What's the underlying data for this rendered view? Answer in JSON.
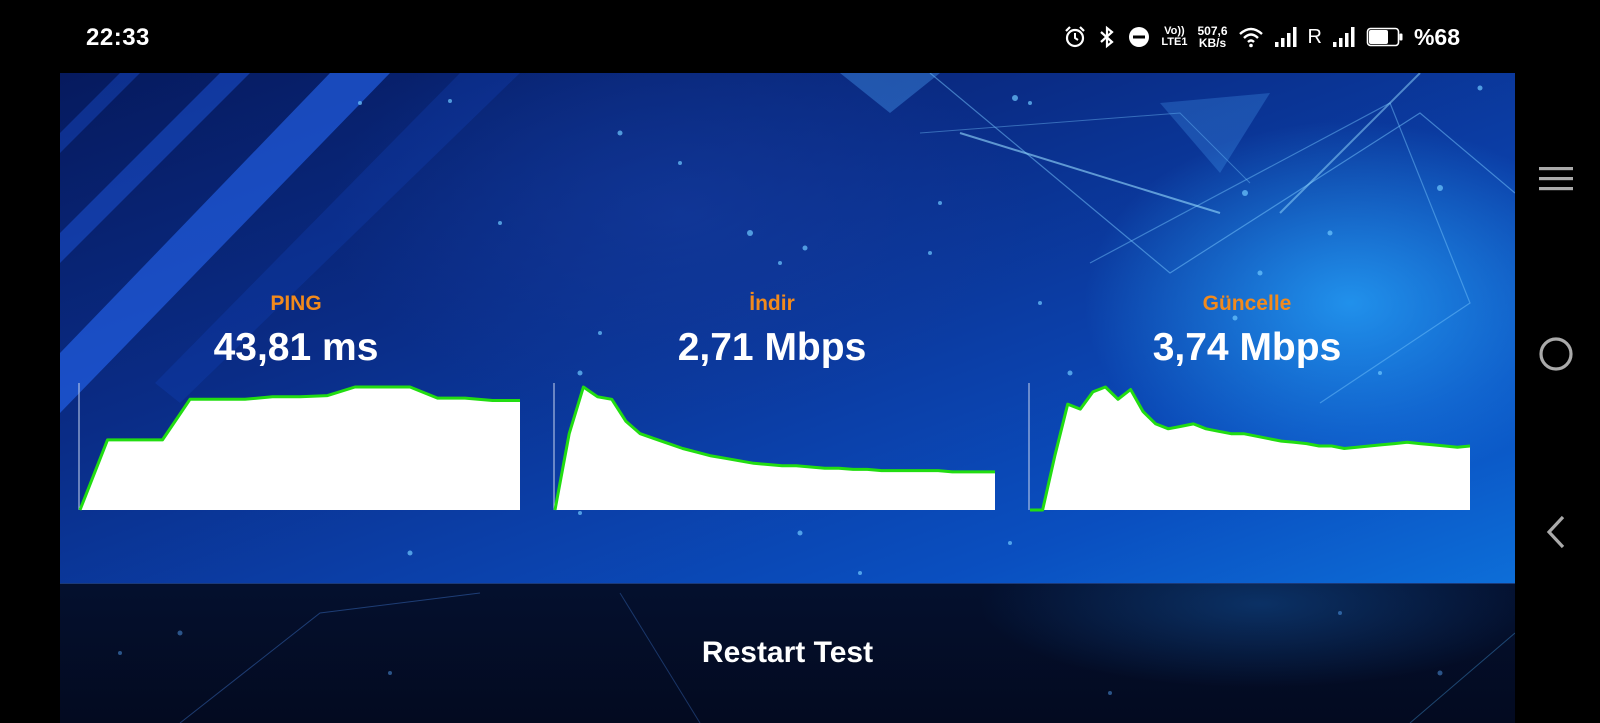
{
  "status_bar": {
    "time": "22:33",
    "volte_top": "Vo))",
    "volte_bottom": "LTE1",
    "net_speed_value": "507,6",
    "net_speed_unit": "KB/s",
    "roaming_label": "R",
    "battery_percent": "%68",
    "battery_level": 0.68,
    "icons": [
      "alarm-icon",
      "bluetooth-icon",
      "do-not-disturb-icon",
      "volte-icon",
      "wifi-icon",
      "signal-icon",
      "signal-icon",
      "battery-icon"
    ]
  },
  "results": {
    "ping": {
      "label": "PING",
      "value": "43,81 ms",
      "trend": [
        0,
        0.57,
        0.57,
        0.57,
        0.9,
        0.9,
        0.9,
        0.92,
        0.92,
        0.93,
        1.0,
        1.0,
        1.0,
        0.91,
        0.91,
        0.89,
        0.89
      ]
    },
    "download": {
      "label": "İndir",
      "value": "2,71 Mbps",
      "trend": [
        0,
        0.62,
        1.0,
        0.92,
        0.9,
        0.72,
        0.62,
        0.58,
        0.54,
        0.5,
        0.47,
        0.44,
        0.42,
        0.4,
        0.38,
        0.37,
        0.36,
        0.36,
        0.35,
        0.34,
        0.34,
        0.33,
        0.33,
        0.32,
        0.32,
        0.32,
        0.32,
        0.32,
        0.31,
        0.31,
        0.31,
        0.31
      ]
    },
    "upload": {
      "label": "Güncelle",
      "value": "3,74 Mbps",
      "trend": [
        0,
        0,
        0.45,
        0.86,
        0.82,
        0.96,
        1.0,
        0.9,
        0.98,
        0.8,
        0.7,
        0.66,
        0.68,
        0.7,
        0.66,
        0.64,
        0.62,
        0.62,
        0.6,
        0.58,
        0.56,
        0.55,
        0.54,
        0.52,
        0.52,
        0.5,
        0.51,
        0.52,
        0.53,
        0.54,
        0.55,
        0.54,
        0.53,
        0.52,
        0.51,
        0.52
      ]
    }
  },
  "restart_button": {
    "label": "Restart Test"
  },
  "nav_bar": {
    "icons": [
      "menu-icon",
      "home-icon",
      "back-icon"
    ]
  },
  "colors": {
    "label_orange": "#f28a1c",
    "graph_line": "#22dd11",
    "graph_fill": "#ffffff"
  }
}
